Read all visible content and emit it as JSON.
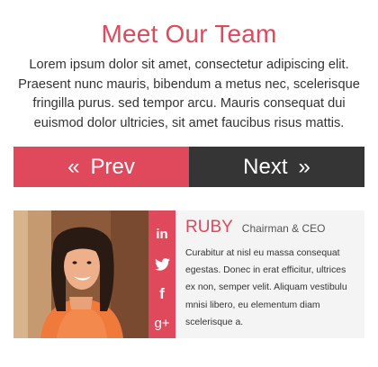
{
  "section": {
    "title": "Meet Our Team",
    "intro": "Lorem ipsum dolor sit amet, consectetur adipiscing elit. Praesent nunc mauris, bibendum a metus nec, scelerisque fringilla purus. sed tempor arcu. Mauris consequat dui euismod dolor ultricies, sit amet faucibus risus mattis."
  },
  "nav": {
    "prev_label": "Prev",
    "prev_icon": "«",
    "next_label": "Next",
    "next_icon": "»"
  },
  "member": {
    "name": "RUBY",
    "role": "Chairman & CEO",
    "bio": "Curabitur at nisl eu massa consequat egestas. Donec in erat efficitur, ultrices ex non, semper velit. Aliquam vestibulu mnisi libero, eu elementum diam scelerisque a.",
    "social": [
      {
        "name": "linkedin-icon",
        "glyph": "in"
      },
      {
        "name": "twitter-icon",
        "glyph": "twitter"
      },
      {
        "name": "facebook-icon",
        "glyph": "f"
      },
      {
        "name": "google-plus-icon",
        "glyph": "g+"
      }
    ]
  },
  "colors": {
    "accent": "#e0495b",
    "dark": "#353535",
    "card_bg": "#f4f4f4"
  }
}
